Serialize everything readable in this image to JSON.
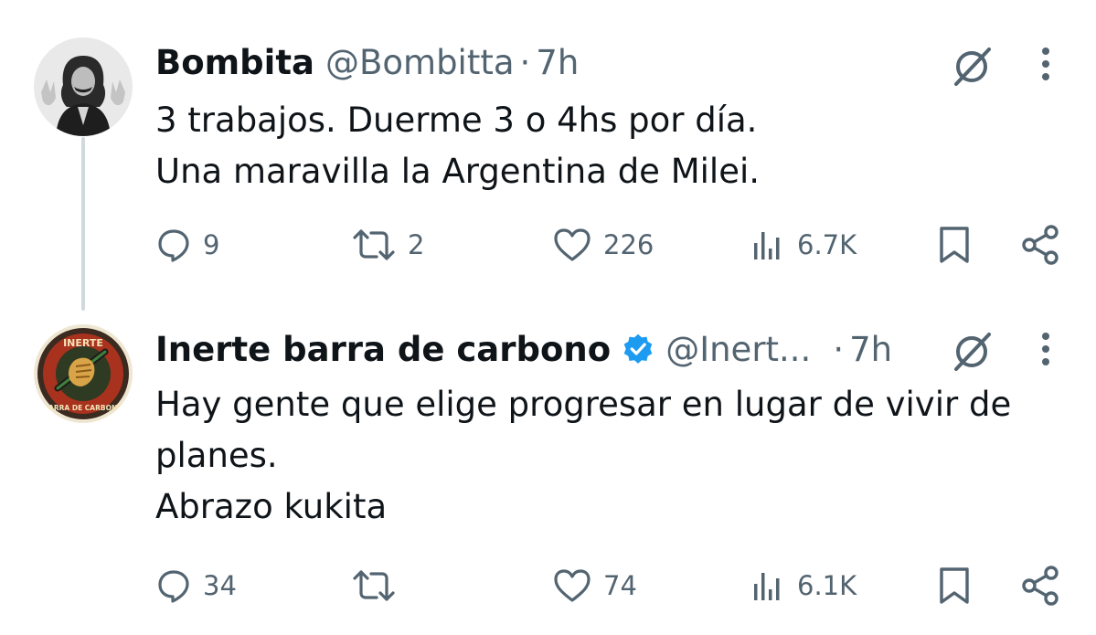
{
  "tweets": [
    {
      "author_name": "Bombita",
      "handle": "@Bombitta",
      "separator": "·",
      "time": "7h",
      "lines": [
        "3 trabajos. Duerme 3 o 4hs por día.",
        "Una maravilla la Argentina de Milei."
      ],
      "replies": "9",
      "retweets": "2",
      "likes": "226",
      "views": "6.7K",
      "avatar_icon": "man-with-long-hair-photo-icon",
      "verified": false
    },
    {
      "author_name": "Inerte barra de carbono",
      "handle": "@Inert...",
      "separator": "·",
      "time": "7h",
      "lines": [
        "Hay gente que elige progresar en lugar de vivir de",
        "planes.",
        "Abrazo kukita"
      ],
      "replies": "34",
      "retweets": "",
      "likes": "74",
      "views": "6.1K",
      "avatar_icon": "fist-holding-carbon-bar-emblem-icon",
      "avatar_badge_text": [
        "INERTE",
        "BARRA DE CARBONO"
      ],
      "verified": true
    }
  ],
  "colors": {
    "text": "#0f1419",
    "muted": "#536471",
    "verified": "#1d9bf0",
    "thread_line": "#cfd9de"
  }
}
